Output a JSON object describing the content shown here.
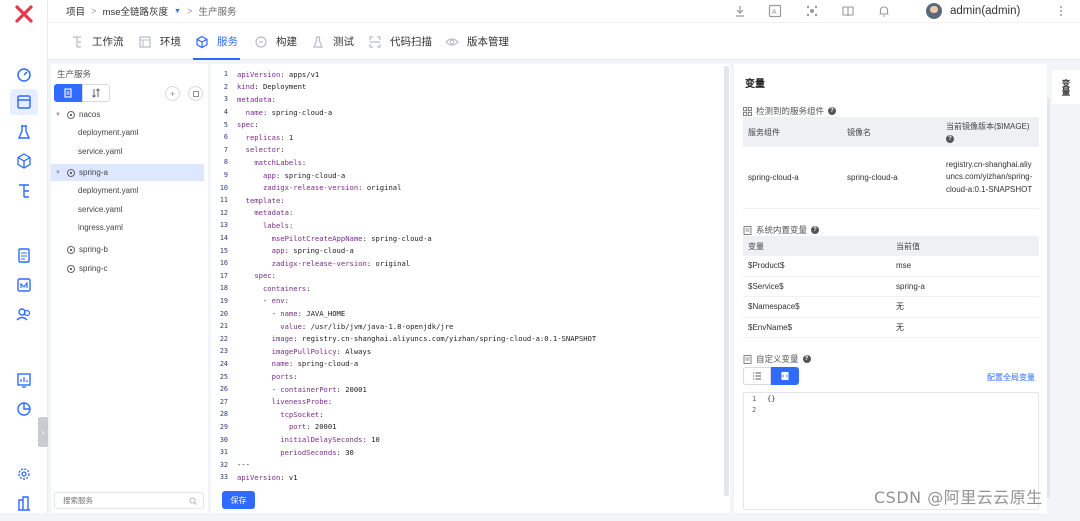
{
  "breadcrumb": {
    "project": "项目",
    "sep": ">",
    "app": "mse全链路灰度",
    "env": "生产服务"
  },
  "user": {
    "name": "admin(admin)"
  },
  "tabs": [
    {
      "label": "工作流",
      "icon": "workflow-icon"
    },
    {
      "label": "环境",
      "icon": "environment-icon"
    },
    {
      "label": "服务",
      "icon": "service-icon",
      "active": true
    },
    {
      "label": "构建",
      "icon": "build-icon"
    },
    {
      "label": "测试",
      "icon": "test-icon"
    },
    {
      "label": "代码扫描",
      "icon": "scan-icon"
    },
    {
      "label": "版本管理",
      "icon": "version-icon"
    }
  ],
  "tree": {
    "title": "生产服务",
    "search_placeholder": "搜索服务",
    "nodes": [
      {
        "label": "nacos",
        "type": "service"
      },
      {
        "label": "deployment.yaml",
        "type": "file"
      },
      {
        "label": "service.yaml",
        "type": "file"
      },
      {
        "label": "spring-a",
        "type": "service",
        "selected": true
      },
      {
        "label": "deployment.yaml",
        "type": "file"
      },
      {
        "label": "service.yaml",
        "type": "file"
      },
      {
        "label": "ingress.yaml",
        "type": "file"
      },
      {
        "label": "spring-b",
        "type": "service"
      },
      {
        "label": "spring-c",
        "type": "service"
      }
    ]
  },
  "editor": {
    "save_label": "保存",
    "lines": [
      {
        "n": "1",
        "indent": "",
        "k": "apiVersion",
        "v": " apps/v1"
      },
      {
        "n": "2",
        "indent": "",
        "k": "kind",
        "v": " Deployment"
      },
      {
        "n": "3",
        "indent": "",
        "k": "metadata",
        "v": ""
      },
      {
        "n": "4",
        "indent": "  ",
        "k": "name",
        "v": " spring-cloud-a"
      },
      {
        "n": "5",
        "indent": "",
        "k": "spec",
        "v": ""
      },
      {
        "n": "6",
        "indent": "  ",
        "k": "replicas",
        "v": " 1"
      },
      {
        "n": "7",
        "indent": "  ",
        "k": "selector",
        "v": ""
      },
      {
        "n": "8",
        "indent": "    ",
        "k": "matchLabels",
        "v": ""
      },
      {
        "n": "9",
        "indent": "      ",
        "k": "app",
        "v": " spring-cloud-a"
      },
      {
        "n": "10",
        "indent": "      ",
        "k": "zadigx-release-version",
        "v": " original"
      },
      {
        "n": "11",
        "indent": "  ",
        "k": "template",
        "v": ""
      },
      {
        "n": "12",
        "indent": "    ",
        "k": "metadata",
        "v": ""
      },
      {
        "n": "13",
        "indent": "      ",
        "k": "labels",
        "v": ""
      },
      {
        "n": "14",
        "indent": "        ",
        "k": "msePilotCreateAppName",
        "v": " spring-cloud-a"
      },
      {
        "n": "15",
        "indent": "        ",
        "k": "app",
        "v": " spring-cloud-a"
      },
      {
        "n": "16",
        "indent": "        ",
        "k": "zadigx-release-version",
        "v": " original"
      },
      {
        "n": "17",
        "indent": "    ",
        "k": "spec",
        "v": ""
      },
      {
        "n": "18",
        "indent": "      ",
        "k": "containers",
        "v": ""
      },
      {
        "n": "19",
        "indent": "      ",
        "dash": "- ",
        "k": "env",
        "v": ""
      },
      {
        "n": "20",
        "indent": "        ",
        "dash": "- ",
        "k": "name",
        "v": " JAVA_HOME"
      },
      {
        "n": "21",
        "indent": "          ",
        "k": "value",
        "v": " /usr/lib/jvm/java-1.8-openjdk/jre"
      },
      {
        "n": "22",
        "indent": "        ",
        "k": "image",
        "v": " registry.cn-shanghai.aliyuncs.com/yizhan/spring-cloud-a:0.1-SNAPSHOT"
      },
      {
        "n": "23",
        "indent": "        ",
        "k": "imagePullPolicy",
        "v": " Always"
      },
      {
        "n": "24",
        "indent": "        ",
        "k": "name",
        "v": " spring-cloud-a"
      },
      {
        "n": "25",
        "indent": "        ",
        "k": "ports",
        "v": ""
      },
      {
        "n": "26",
        "indent": "        ",
        "dash": "- ",
        "k": "containerPort",
        "v": " 20001"
      },
      {
        "n": "27",
        "indent": "        ",
        "k": "livenessProbe",
        "v": ""
      },
      {
        "n": "28",
        "indent": "          ",
        "k": "tcpSocket",
        "v": ""
      },
      {
        "n": "29",
        "indent": "            ",
        "k": "port",
        "v": " 20001"
      },
      {
        "n": "30",
        "indent": "          ",
        "k": "initialDelaySeconds",
        "v": " 10"
      },
      {
        "n": "31",
        "indent": "          ",
        "k": "periodSeconds",
        "v": " 30"
      },
      {
        "n": "32",
        "indent": "",
        "k": "",
        "v": "---"
      },
      {
        "n": "33",
        "indent": "",
        "k": "apiVersion",
        "v": " v1"
      }
    ]
  },
  "vars": {
    "title": "变量",
    "detected": {
      "title": "检测到的服务组件",
      "headers": [
        "服务组件",
        "镜像名",
        "当前镜像版本($IMAGE)"
      ],
      "rows": [
        {
          "component": "spring-cloud-a",
          "image": "spring-cloud-a",
          "version": "registry.cn-shanghai.aliyuncs.com/yizhan/spring-cloud-a:0.1-SNAPSHOT"
        }
      ]
    },
    "builtin": {
      "title": "系统内置变量",
      "headers": [
        "变量",
        "当前值"
      ],
      "rows": [
        {
          "name": "$Product$",
          "value": "mse"
        },
        {
          "name": "$Service$",
          "value": "spring-a"
        },
        {
          "name": "$Namespace$",
          "value": "无"
        },
        {
          "name": "$EnvName$",
          "value": "无"
        }
      ]
    },
    "custom": {
      "title": "自定义变量",
      "config_link": "配置全局变量",
      "lines": [
        {
          "n": "1",
          "text": "{}"
        },
        {
          "n": "2",
          "text": ""
        }
      ]
    }
  },
  "right_tab": "变量",
  "watermark": "CSDN @阿里云云原生",
  "colors": {
    "accent": "#2f6bff",
    "selected_bg": "#dde7ff",
    "brand_logo": "#e8384f"
  }
}
